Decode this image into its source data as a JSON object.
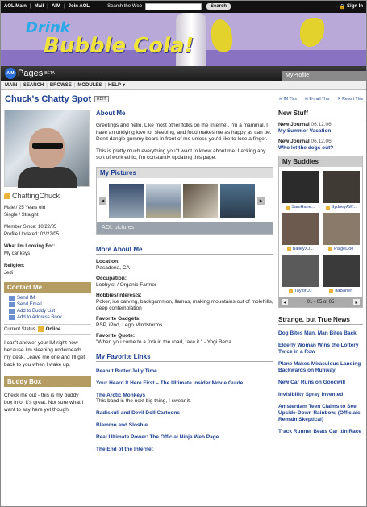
{
  "topbar": {
    "aol_main": "AOL Main",
    "mail": "Mail",
    "aim": "AIM",
    "join": "Join AOL",
    "search_label": "Search the Web",
    "search_placeholder": "",
    "search_button": "Search",
    "sign_in": "Sign In"
  },
  "banner": {
    "drink": "Drink",
    "bubble": "Bubble Cola!"
  },
  "header": {
    "logo_badge": "AIM",
    "logo_text": "Pages",
    "beta": "BETA",
    "my_profile": "MyProfile"
  },
  "menu": [
    "MAIN",
    "SEARCH",
    "BROWSE",
    "MODULES",
    "HELP"
  ],
  "page": {
    "title": "Chuck's Chatty Spot",
    "edit": "EDIT",
    "im_this": "IM This",
    "email_this": "E-mail This",
    "report_this": "Report This"
  },
  "profile": {
    "username": "ChattingChuck",
    "age_gender": "Male / 25 Years old",
    "status_line": "Single / Straight",
    "member_since": "Member Since: 10/22/05",
    "updated": "Profile Updated: 02/22/05",
    "looking_label": "What I'm Looking For:",
    "looking_value": "My car keys",
    "religion_label": "Religion:",
    "religion_value": "Jedi"
  },
  "contact": {
    "title": "Contact Me",
    "items": [
      "Send IM",
      "Send Email",
      "Add to Buddy List",
      "Add to Address Book"
    ],
    "status_label": "Current Status",
    "status_value": "Online",
    "away_message": "I can't answer your IM right now because I'm sleeping underneath my desk. Leave me one and I'll get back to you when I wake up."
  },
  "buddybox": {
    "title": "Buddy Box",
    "text": "Check me out - this is my buddy box info. It's great. Not sure what I want to say here yet though."
  },
  "about": {
    "title": "About Me",
    "p1": "Greetings and hello. Like most other folks on the Internet, I'm a mammal. I have an undying love for sleeping, and food makes me as happy as can be. Don't dangle gummy bears in front of me unless you'd like to lose a finger.",
    "p2": "This is pretty much everything you'd want to know about me. Lacking any sort of work ethic, I'm constantly updating this page."
  },
  "pictures": {
    "title": "My Pictures",
    "footer": "AOL pictures",
    "thumbs": [
      "#3a4f6e",
      "#7d8fa2",
      "#5b4f40",
      "#4e6f8c",
      "#6c6c70"
    ]
  },
  "more": {
    "title": "More About Me",
    "location_label": "Location:",
    "location": "Pasadena, CA",
    "occupation_label": "Occupation:",
    "occupation": "Lobbyist / Organic Farmer",
    "hobbies_label": "Hobbies/Interests:",
    "hobbies": "Poker, ice carving, backgammon, llamas, making mountains out of molehills, deep contemplation",
    "gadgets_label": "Favorite Gadgets:",
    "gadgets": "PSP, iPod, Lego Mindstorms",
    "quote_label": "Favorite Quote:",
    "quote": "\"When you come to a fork in the road, take it.\" - Yogi Berra"
  },
  "links": {
    "title": "My Favorite Links",
    "items": [
      {
        "text": "Peanut Butter Jelly Time",
        "desc": ""
      },
      {
        "text": "Your Heard It Here First – The Ultimate Insider Movie Guide",
        "desc": ""
      },
      {
        "text": "The Arctic Monkeys",
        "desc": "This band is the next big thing, I swear it."
      },
      {
        "text": "Radiskull and Devil Doll Cartoons",
        "desc": ""
      },
      {
        "text": "Blammo and Sloshie",
        "desc": ""
      },
      {
        "text": "Real Ultimate Power: The Official Ninja Web Page",
        "desc": ""
      },
      {
        "text": "The End of the Internet",
        "desc": ""
      }
    ]
  },
  "newstuff": {
    "title": "New Stuff",
    "items": [
      {
        "journal": "New Journal",
        "date": "06.12.06",
        "link": "My Summer Vacation"
      },
      {
        "journal": "New Journal",
        "date": "06.12.06",
        "link": "Who let the dogs out?"
      }
    ]
  },
  "buddies": {
    "title": "My Buddies",
    "list": [
      {
        "name": "SamHane...",
        "color": "#2b2b2b"
      },
      {
        "name": "SydneyAW...",
        "color": "#3f3a34"
      },
      {
        "name": "BaileyXJ...",
        "color": "#6b5a4d"
      },
      {
        "name": "PaigeDoo",
        "color": "#8a7a6a"
      },
      {
        "name": "TaylorDJ",
        "color": "#5a5a5a"
      },
      {
        "name": "ItaBarien",
        "color": "#3a3a3a"
      }
    ],
    "pager": "01 - 05 of 05"
  },
  "strange": {
    "title": "Strange, but True News",
    "items": [
      "Dog Bites Man, Man Bites Back",
      "Elderly Woman Wins the Lottery Twice in a Row",
      "Plane Makes Miraculous Landing Backwards on Runway",
      "New Car Runs on Goodwill",
      "Invisibility Spray Invented",
      "Amsterdam Teen Claims to See Upside-Down Rainbow, (Officials Remain Skeptical)",
      "Track Runner Beats Car ttin Race"
    ]
  }
}
